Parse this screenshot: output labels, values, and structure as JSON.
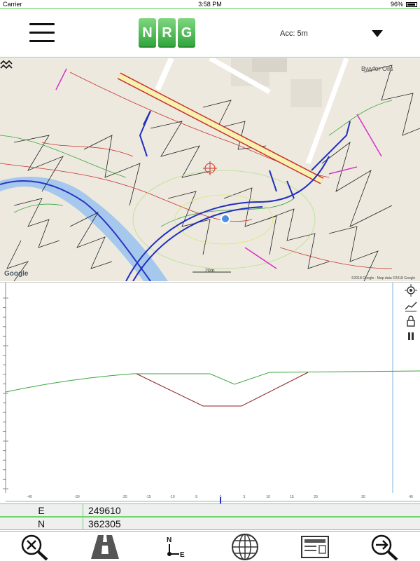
{
  "status_bar": {
    "carrier": "Carrier",
    "time": "3:58 PM",
    "battery": "96%"
  },
  "header": {
    "logo_letters": [
      "N",
      "R",
      "G"
    ],
    "accuracy": "Acc: 5m",
    "brand_color": "#3cb043"
  },
  "map": {
    "place_label": "Bwyfor Oils",
    "scale": "20m",
    "google": "Google",
    "attribution": "©2018 Google · Map data ©2018 Google"
  },
  "profile": {
    "x_ticks": [
      "-40",
      "-30",
      "-20",
      "-15",
      "-10",
      "-5",
      "0",
      "5",
      "10",
      "15",
      "20",
      "30",
      "40"
    ],
    "colors": {
      "ground": "#3aa53a",
      "trench": "#8b2020",
      "marker": "#7fb3e6"
    }
  },
  "coords": {
    "e_label": "E",
    "e_value": "249610",
    "n_label": "N",
    "n_value": "362305"
  },
  "toolbar": {
    "icons": [
      "zoom-cancel-icon",
      "road-icon",
      "north-east-icon",
      "globe-icon",
      "card-icon",
      "zoom-next-icon"
    ]
  }
}
